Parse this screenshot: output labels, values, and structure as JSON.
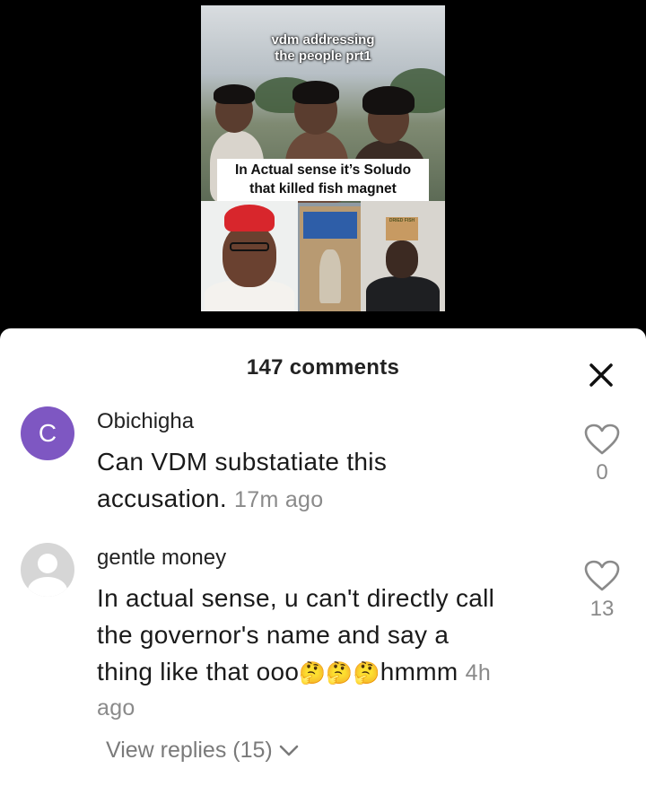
{
  "video": {
    "caption_top": [
      "vdm addressing",
      "the people prt1"
    ],
    "caption_mid": [
      "In Actual sense it’s Soludo",
      "that killed fish magnet"
    ],
    "sign_text": "DRIED FISH"
  },
  "comments_header": {
    "count_label": "147 comments",
    "close_icon": "close-icon"
  },
  "comments": [
    {
      "username": "Obichigha",
      "avatar_letter": "C",
      "avatar_color": "#7e57c2",
      "text": "Can VDM substatiate this accusation.",
      "time": "17m ago",
      "likes": "0"
    },
    {
      "username": "gentle money",
      "text_line1": "In actual sense, u can't directly call",
      "text_line2": "the governor's name and say a",
      "text_line3_prefix": "thing like that ooo",
      "emojis": "🤔🤔🤔",
      "text_line3_suffix": "hmmm",
      "time_part1": "4h",
      "time_part2": "ago",
      "likes": "13",
      "view_replies": "View replies (15)"
    }
  ]
}
